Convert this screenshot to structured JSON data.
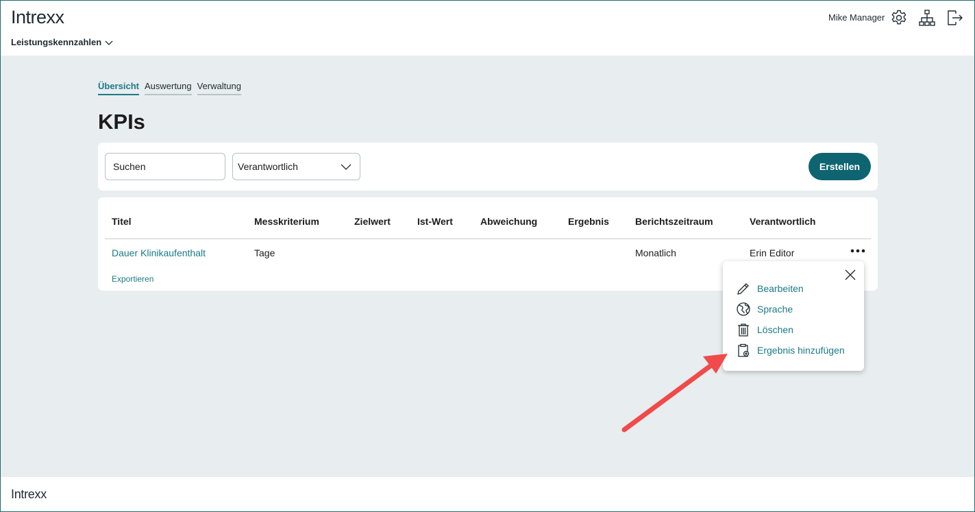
{
  "header": {
    "logo": "Intrexx",
    "app_name": "Leistungskennzahlen",
    "user_name": "Mike Manager",
    "icons": [
      "gear-icon",
      "sitemap-icon",
      "logout-icon"
    ]
  },
  "tabs": [
    {
      "label": "Übersicht",
      "active": true
    },
    {
      "label": "Auswertung",
      "active": false
    },
    {
      "label": "Verwaltung",
      "active": false
    }
  ],
  "page_title": "KPIs",
  "filters": {
    "search_placeholder": "Suchen",
    "responsible_select": "Verantwortlich",
    "create_label": "Erstellen"
  },
  "table": {
    "columns": [
      "Titel",
      "Messkriterium",
      "Zielwert",
      "Ist-Wert",
      "Abweichung",
      "Ergebnis",
      "Berichtszeitraum",
      "Verantwortlich"
    ],
    "rows": [
      {
        "titel": "Dauer Klinikaufenthalt",
        "messkriterium": "Tage",
        "zielwert": "",
        "ist_wert": "",
        "abweichung": "",
        "ergebnis": "",
        "berichtszeitraum": "Monatlich",
        "verantwortlich": "Erin Editor"
      }
    ],
    "export_label": "Exportieren"
  },
  "context_menu": {
    "items": [
      {
        "label": "Bearbeiten",
        "icon": "pencil-icon"
      },
      {
        "label": "Sprache",
        "icon": "globe-icon"
      },
      {
        "label": "Löschen",
        "icon": "trash-icon"
      },
      {
        "label": "Ergebnis hinzufügen",
        "icon": "clipboard-add-icon"
      }
    ]
  },
  "footer": {
    "logo": "Intrexx"
  },
  "colors": {
    "accent": "#1a7a86",
    "primary_button": "#0e6470",
    "background": "#e8edf0",
    "annotation_arrow": "#f04a4a"
  }
}
